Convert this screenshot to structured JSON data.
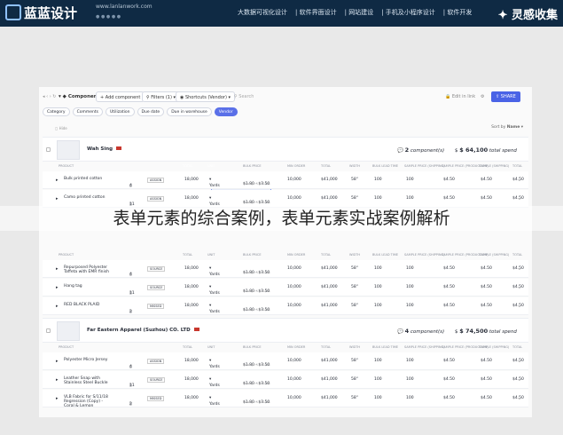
{
  "site": {
    "logo": "蓝蓝设计",
    "url": "www.lanlanwork.com",
    "nav": [
      "大数据可视化设计",
      "软件界面设计",
      "网站建设",
      "手机及小程序设计",
      "软件开发"
    ],
    "brand": "灵感收集"
  },
  "toolbar": {
    "title": "Components",
    "add": "+ Add component",
    "filters": "Filters (1)",
    "shortcuts": "Shortcuts (Vendor)",
    "search": "Search",
    "edit": "Edit in link",
    "share": "SHARE"
  },
  "tabs": [
    "Category",
    "Comments",
    "Utilization",
    "Due date",
    "Due in warehouse",
    "Vendor"
  ],
  "active_tab": "Vendor",
  "hint": "Hide",
  "sort": {
    "label": "Sort by",
    "value": "Name"
  },
  "columns": [
    "PRODUCT",
    "TOTAL",
    "UNIT",
    "BULK PRICE",
    "MIN ORDER",
    "TOTAL",
    "WIDTH",
    "BULK LEAD TIME",
    "SAMPLE PRICE (SHIPPING)",
    "SAMPLE PRICE (PRODUCTION)",
    "SAMPLE (SHIPPING)",
    "TOTAL"
  ],
  "suppliers": [
    {
      "name": "Wah Sing",
      "components": "2",
      "components_label": "component(s)",
      "spend": "$ 64,100",
      "spend_label": "total spend",
      "rows": [
        {
          "name": "Bulk printed cotton",
          "docs": "4",
          "tag": "ASSIGN",
          "total": "18,000",
          "unit": "Yards",
          "price": "$1.80 - $3.50",
          "min": "10,000",
          "tot": "$41,000",
          "width": "58\"",
          "lead": "100",
          "s1": "100",
          "s2": "$4.50",
          "s3": "$4.50",
          "s4": "$4.50"
        },
        {
          "name": "Camo printed cotton",
          "docs": "11",
          "tag": "ASSIGN",
          "total": "18,000",
          "unit": "Yards",
          "price": "$1.80 - $3.50",
          "min": "10,000",
          "tot": "$41,000",
          "width": "58\"",
          "lead": "100",
          "s1": "100",
          "s2": "$4.50",
          "s3": "$4.50",
          "s4": "$4.50"
        }
      ]
    },
    {
      "rows": [
        {
          "name": "Repurposed Polyester Taffeta with EMR finish",
          "docs": "4",
          "tag": "SOURCE",
          "total": "18,000",
          "unit": "Yards",
          "price": "$1.80 - $3.50",
          "min": "10,000",
          "tot": "$41,000",
          "width": "58\"",
          "lead": "100",
          "s1": "100",
          "s2": "$4.50",
          "s3": "$4.50",
          "s4": "$4.50"
        },
        {
          "name": "Hang tag",
          "docs": "11",
          "tag": "SOURCE",
          "total": "18,000",
          "unit": "Yards",
          "price": "$1.80 - $3.50",
          "min": "10,000",
          "tot": "$41,000",
          "width": "58\"",
          "lead": "100",
          "s1": "100",
          "s2": "$4.50",
          "s3": "$4.50",
          "s4": "$4.50"
        },
        {
          "name": "RED BLACK PLAID",
          "docs": "2",
          "tag": "MISSED",
          "total": "18,000",
          "unit": "Yards",
          "price": "$1.80 - $3.50",
          "min": "10,000",
          "tot": "$41,000",
          "width": "58\"",
          "lead": "100",
          "s1": "100",
          "s2": "$4.50",
          "s3": "$4.50",
          "s4": "$4.50"
        }
      ]
    },
    {
      "name": "Far Eastern Apparel (Suzhou) CO. LTD",
      "components": "4",
      "components_label": "component(s)",
      "spend": "$ 74,500",
      "spend_label": "total spend",
      "rows": [
        {
          "name": "Polyester Micro Jersey",
          "docs": "4",
          "tag": "ASSIGN",
          "total": "18,000",
          "unit": "Yards",
          "price": "$1.80 - $3.50",
          "min": "10,000",
          "tot": "$41,000",
          "width": "58\"",
          "lead": "100",
          "s1": "100",
          "s2": "$4.50",
          "s3": "$4.50",
          "s4": "$4.50"
        },
        {
          "name": "Leather Snap with Stainless Steel Buckle",
          "docs": "11",
          "tag": "SOURCE",
          "total": "18,000",
          "unit": "Yards",
          "price": "$1.80 - $3.50",
          "min": "10,000",
          "tot": "$41,000",
          "width": "58\"",
          "lead": "100",
          "s1": "100",
          "s2": "$4.50",
          "s3": "$4.50",
          "s4": "$4.50"
        },
        {
          "name": "VLB Fabric for S/11/18 Regression (Copy) - Coral & Lemon",
          "docs": "2",
          "tag": "MISSED",
          "total": "18,000",
          "unit": "Yards",
          "price": "$1.80 - $3.50",
          "min": "10,000",
          "tot": "$41,000",
          "width": "58\"",
          "lead": "100",
          "s1": "100",
          "s2": "$4.50",
          "s3": "$4.50",
          "s4": "$4.50"
        }
      ]
    }
  ],
  "watermark": "表单元素的综合案例，表单元素实战案例解析"
}
